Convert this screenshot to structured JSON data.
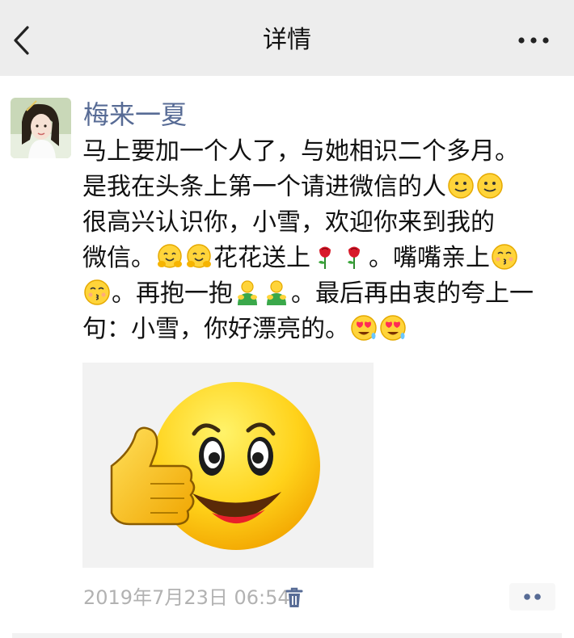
{
  "header": {
    "title": "详情",
    "back_icon": "chevron-left-icon",
    "more_icon": "more-dots-icon"
  },
  "post": {
    "author": "梅来一夏",
    "lines": [
      [
        {
          "t": "马上要加一个人了，与她相识二个多月。"
        }
      ],
      [
        {
          "t": "是我在头条上第一个请进微信的人"
        },
        {
          "e": "smile"
        },
        {
          "e": "smile"
        }
      ],
      [
        {
          "t": "很高兴认识你，小雪，欢迎你来到我的"
        }
      ],
      [
        {
          "t": "微信。"
        },
        {
          "e": "hug"
        },
        {
          "e": "hug"
        },
        {
          "t": "花花送上"
        },
        {
          "e": "rose"
        },
        {
          "e": "rose"
        },
        {
          "t": "。嘴嘴亲上"
        },
        {
          "e": "kiss"
        }
      ],
      [
        {
          "e": "kiss"
        },
        {
          "t": "。再抱一抱"
        },
        {
          "e": "hugman"
        },
        {
          "e": "hugman"
        },
        {
          "t": "。最后再由衷的夸上一"
        }
      ],
      [
        {
          "t": "句：小雪，你好漂亮的。"
        },
        {
          "e": "hearteyes"
        },
        {
          "e": "hearteyes"
        }
      ]
    ],
    "timestamp": "2019年7月23日 06:54",
    "delete_icon": "trash-icon",
    "action_icon": "more-dots-icon",
    "image_icon": "thumbs-up-smiley-icon"
  },
  "colors": {
    "header_bg": "#ededed",
    "author": "#576b95",
    "timestamp": "#b2b2b2",
    "emoji_yellow": "#ffcc22"
  }
}
